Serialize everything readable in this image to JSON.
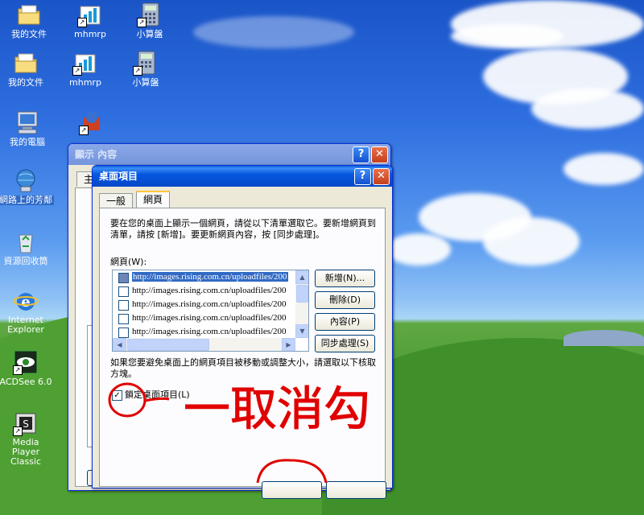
{
  "desktop": {
    "icons_row_top": [
      {
        "label": "我的文件",
        "icon": "my-documents-icon"
      },
      {
        "label": "mhmrp",
        "icon": "mhmrp-shortcut-icon"
      },
      {
        "label": "小算盤",
        "icon": "calculator-icon"
      }
    ],
    "icons_row_second": [
      {
        "label": "我的文件",
        "icon": "my-documents-icon"
      },
      {
        "label": "mhmrp",
        "icon": "mhmrp-shortcut-icon"
      },
      {
        "label": "小算盤",
        "icon": "calculator-icon"
      }
    ],
    "icons_column": [
      {
        "label": "我的電腦",
        "icon": "my-computer-icon"
      },
      {
        "label": "網路上的芳鄰",
        "icon": "network-places-icon"
      },
      {
        "label": "資源回收筒",
        "icon": "recycle-bin-icon"
      },
      {
        "label": "Internet Explorer",
        "icon": "internet-explorer-icon"
      },
      {
        "label": "ACDSee 6.0",
        "icon": "acdsee-icon"
      },
      {
        "label": "Media Player Classic",
        "icon": "media-player-classic-icon"
      }
    ]
  },
  "display_window": {
    "title": "顯示 內容",
    "tab_partial": "主",
    "help_glyph": "?",
    "close_glyph": "✕"
  },
  "desktop_items_dialog": {
    "title": "桌面項目",
    "help_glyph": "?",
    "close_glyph": "✕",
    "tabs": [
      "一般",
      "網頁"
    ],
    "active_tab": "網頁",
    "description": "要在您的桌面上顯示一個網頁，請從以下清單選取它。要新增網頁到清單，請按 [新增]。要更新網頁內容，按 [同步處理]。",
    "list_label": "網頁(W):",
    "web_pages": [
      {
        "url": "http://images.rising.com.cn/uploadfiles/200",
        "selected": true
      },
      {
        "url": "http://images.rising.com.cn/uploadfiles/200",
        "selected": false
      },
      {
        "url": "http://images.rising.com.cn/uploadfiles/200",
        "selected": false
      },
      {
        "url": "http://images.rising.com.cn/uploadfiles/200",
        "selected": false
      },
      {
        "url": "http://images.rising.com.cn/uploadfiles/200",
        "selected": false
      }
    ],
    "buttons": {
      "new": "新增(N)...",
      "delete": "刪除(D)",
      "properties": "內容(P)",
      "sync": "同步處理(S)"
    },
    "lock_text": "如果您要避免桌面上的網頁項目被移動或調整大小，請選取以下核取方塊。",
    "lock_checkbox_label": "鎖定桌面項目(L)",
    "lock_checked": true
  },
  "annotation": {
    "handwritten_text": "一取消勾",
    "color": "#e00000"
  },
  "colors": {
    "title_active": "#0658e0",
    "selection": "#316ac5",
    "dialog_bg": "#ece9d8"
  }
}
